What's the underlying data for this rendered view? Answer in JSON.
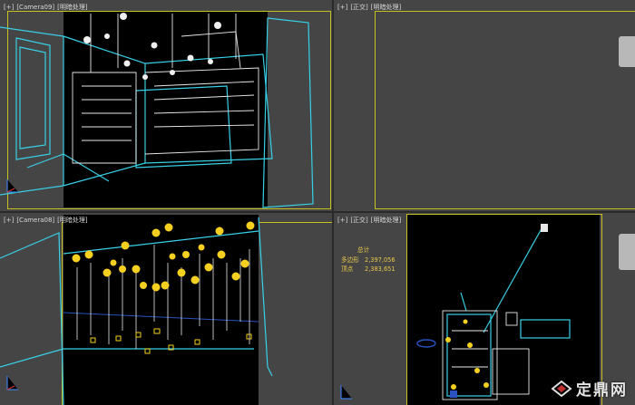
{
  "viewports": {
    "top_left": {
      "plus": "[+]",
      "camera": "[Camera09]",
      "mode": "[明暗处理]"
    },
    "top_right": {
      "plus": "[+]",
      "camera": "[正交]",
      "mode": "[明暗处理]"
    },
    "bottom_left": {
      "plus": "[+]",
      "camera": "[Camera08]",
      "mode": "[明暗处理]"
    },
    "bottom_right": {
      "plus": "[+]",
      "camera": "[正交]",
      "mode": "[明暗处理]"
    }
  },
  "stats": {
    "title": "总计",
    "polygons_label": "多边形",
    "polygons_value": "2,397,056",
    "vertices_label": "顶点",
    "vertices_value": "2,383,651"
  },
  "watermark": {
    "text": "定鼎网"
  },
  "colors": {
    "frame": "#c8c020",
    "wire_cyan": "#38d0e6",
    "wire_white": "#f0f0f0",
    "lamp_yellow": "#f5d020",
    "stats_text": "#e8c84a"
  }
}
